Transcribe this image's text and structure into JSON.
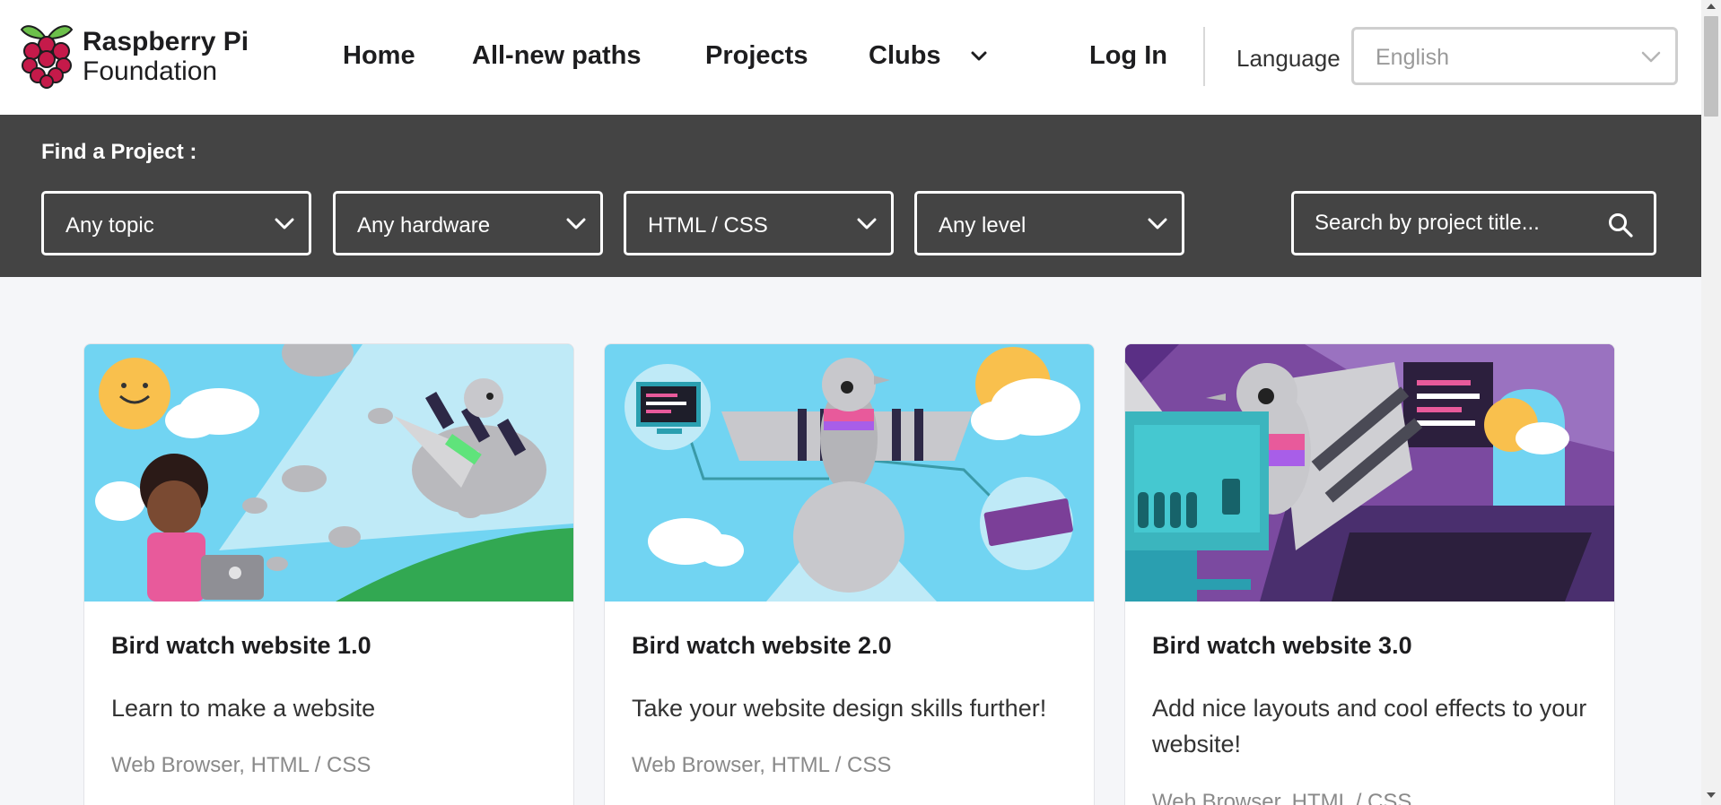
{
  "brand": {
    "line1": "Raspberry Pi",
    "line2": "Foundation"
  },
  "nav": {
    "items": [
      "Home",
      "All-new paths",
      "Projects",
      "Clubs"
    ],
    "login": "Log In",
    "language_label": "Language",
    "language_value": "English"
  },
  "filters": {
    "label": "Find a Project :",
    "topic": "Any topic",
    "hardware": "Any hardware",
    "software": "HTML / CSS",
    "level": "Any level",
    "search_placeholder": "Search by project title..."
  },
  "cards": [
    {
      "title": "Bird watch website 1.0",
      "description": "Learn to make a website",
      "tags": "Web Browser, HTML / CSS"
    },
    {
      "title": "Bird watch website 2.0",
      "description": "Take your website design skills further!",
      "tags": "Web Browser, HTML / CSS"
    },
    {
      "title": "Bird watch website 3.0",
      "description": "Add nice layouts and cool effects to your website!",
      "tags": "Web Browser, HTML / CSS"
    }
  ],
  "colors": {
    "filter_bar": "#444444",
    "page_bg": "#f5f6f9",
    "logo_red": "#c51a4a",
    "logo_green": "#6cc04a"
  },
  "icons": [
    "raspberry-logo-icon",
    "chevron-down-icon",
    "search-icon"
  ]
}
